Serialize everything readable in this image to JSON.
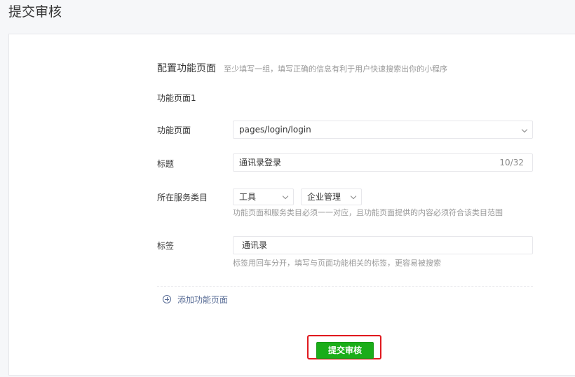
{
  "page": {
    "title": "提交审核"
  },
  "section": {
    "title": "配置功能页面",
    "hint": "至少填写一组，填写正确的信息有利于用户快速搜索出你的小程序",
    "subheading": "功能页面1"
  },
  "form": {
    "function_page": {
      "label": "功能页面",
      "value": "pages/login/login"
    },
    "title": {
      "label": "标题",
      "value": "通讯录登录",
      "count": "10/32"
    },
    "category": {
      "label": "所在服务类目",
      "primary": "工具",
      "secondary": "企业管理",
      "tip": "功能页面和服务类目必须一一对应，且功能页面提供的内容必须符合该类目范围"
    },
    "tags": {
      "label": "标签",
      "value": "通讯录",
      "tip": "标签用回车分开，填写与页面功能相关的标签，更容易被搜索"
    }
  },
  "actions": {
    "add_page": "添加功能页面",
    "submit": "提交审核"
  },
  "colors": {
    "primary_green": "#1aad19",
    "link_blue": "#576b95",
    "highlight_red": "#e0191e"
  }
}
